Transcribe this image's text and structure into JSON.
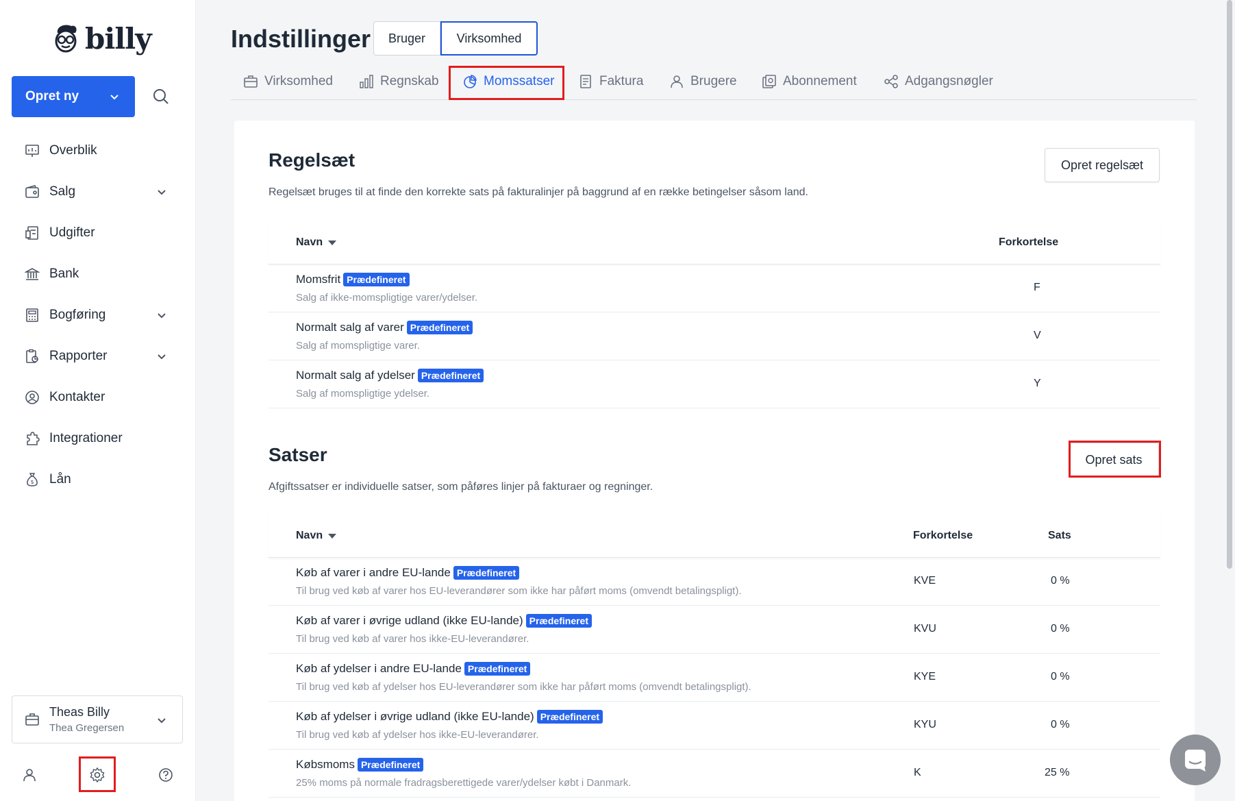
{
  "sidebar": {
    "brand": "billy",
    "create_label": "Opret ny",
    "items": [
      {
        "label": "Overblik",
        "icon": "dashboard-icon",
        "expandable": false
      },
      {
        "label": "Salg",
        "icon": "wallet-icon",
        "expandable": true
      },
      {
        "label": "Udgifter",
        "icon": "receipt-icon",
        "expandable": false
      },
      {
        "label": "Bank",
        "icon": "bank-icon",
        "expandable": false
      },
      {
        "label": "Bogføring",
        "icon": "calculator-icon",
        "expandable": true
      },
      {
        "label": "Rapporter",
        "icon": "report-icon",
        "expandable": true
      },
      {
        "label": "Kontakter",
        "icon": "contact-icon",
        "expandable": false
      },
      {
        "label": "Integrationer",
        "icon": "puzzle-icon",
        "expandable": false
      },
      {
        "label": "Lån",
        "icon": "moneybag-icon",
        "expandable": false
      }
    ],
    "org": {
      "name": "Theas Billy",
      "user": "Thea Gregersen"
    }
  },
  "header": {
    "title": "Indstillinger",
    "segments": [
      "Bruger",
      "Virksomhed"
    ],
    "active_segment": "Virksomhed",
    "tabs": [
      {
        "label": "Virksomhed",
        "icon": "briefcase-icon"
      },
      {
        "label": "Regnskab",
        "icon": "bar-chart-icon"
      },
      {
        "label": "Momssatser",
        "icon": "pie-chart-icon"
      },
      {
        "label": "Faktura",
        "icon": "invoice-icon"
      },
      {
        "label": "Brugere",
        "icon": "user-icon"
      },
      {
        "label": "Abonnement",
        "icon": "subscription-icon"
      },
      {
        "label": "Adgangsnøgler",
        "icon": "key-share-icon"
      }
    ],
    "active_tab": "Momssatser"
  },
  "rulesets": {
    "title": "Regelsæt",
    "description": "Regelsæt bruges til at finde den korrekte sats på fakturalinjer på baggrund af en række betingelser såsom land.",
    "create_label": "Opret regelsæt",
    "columns": {
      "name": "Navn",
      "abbr": "Forkortelse"
    },
    "rows": [
      {
        "name": "Momsfrit",
        "badge": "Prædefineret",
        "desc": "Salg af ikke-momspligtige varer/ydelser.",
        "abbr": "F"
      },
      {
        "name": "Normalt salg af varer",
        "badge": "Prædefineret",
        "desc": "Salg af momspligtige varer.",
        "abbr": "V"
      },
      {
        "name": "Normalt salg af ydelser",
        "badge": "Prædefineret",
        "desc": "Salg af momspligtige ydelser.",
        "abbr": "Y"
      }
    ]
  },
  "rates": {
    "title": "Satser",
    "description": "Afgiftssatser er individuelle satser, som påføres linjer på fakturaer og regninger.",
    "create_label": "Opret sats",
    "columns": {
      "name": "Navn",
      "abbr": "Forkortelse",
      "rate": "Sats"
    },
    "rows": [
      {
        "name": "Køb af varer i andre EU-lande",
        "badge": "Prædefineret",
        "desc": "Til brug ved køb af varer hos EU-leverandører som ikke har påført moms (omvendt betalingspligt).",
        "abbr": "KVE",
        "rate": "0 %"
      },
      {
        "name": "Køb af varer i øvrige udland (ikke EU-lande)",
        "badge": "Prædefineret",
        "desc": "Til brug ved køb af varer hos ikke-EU-leverandører.",
        "abbr": "KVU",
        "rate": "0 %"
      },
      {
        "name": "Køb af ydelser i andre EU-lande",
        "badge": "Prædefineret",
        "desc": "Til brug ved køb af ydelser hos EU-leverandører som ikke har påført moms (omvendt betalingspligt).",
        "abbr": "KYE",
        "rate": "0 %"
      },
      {
        "name": "Køb af ydelser i øvrige udland (ikke EU-lande)",
        "badge": "Prædefineret",
        "desc": "Til brug ved køb af ydelser hos ikke-EU-leverandører.",
        "abbr": "KYU",
        "rate": "0 %"
      },
      {
        "name": "Købsmoms",
        "badge": "Prædefineret",
        "desc": "25% moms på normale fradragsberettigede varer/ydelser købt i Danmark.",
        "abbr": "K",
        "rate": "25 %"
      }
    ]
  },
  "colors": {
    "accent": "#2563eb",
    "highlight": "#e11d1d"
  }
}
